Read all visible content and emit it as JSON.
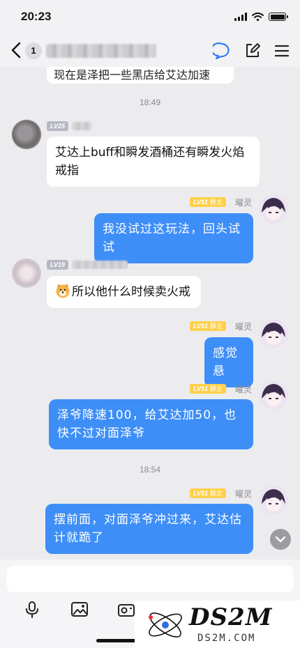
{
  "status_bar": {
    "time": "20:23"
  },
  "header": {
    "unread_count": "1",
    "icons": [
      "back-chevron-icon",
      "chat-bubble-icon",
      "edit-icon",
      "menu-icon"
    ]
  },
  "chat": {
    "top_clipped_text": "现在是泽把一些黑店给艾达加速",
    "time_1": "18:49",
    "time_2": "18:54",
    "messages": [
      {
        "side": "in",
        "level": "LV25",
        "text": "艾达上buff和瞬发酒桶还有瞬发火焰戒指"
      },
      {
        "side": "out",
        "level": "LV51",
        "tag": "群主",
        "nickname": "曜灵",
        "text": "我没试过这玩法，回头试试"
      },
      {
        "side": "in",
        "level": "LV19",
        "emoji": "doge-emoji",
        "text": "所以他什么时候卖火戒"
      },
      {
        "side": "out",
        "level": "LV51",
        "tag": "群主",
        "nickname": "曜灵",
        "text": "感觉悬"
      },
      {
        "side": "out",
        "level": "LV51",
        "tag": "群主",
        "nickname": "曜灵",
        "text": "泽爷降速100，给艾达加50，也快不过对面泽爷"
      },
      {
        "side": "out",
        "level": "LV51",
        "tag": "群主",
        "nickname": "曜灵",
        "text": "摆前面，对面泽爷冲过来，艾达估计就跪了"
      }
    ]
  },
  "input": {
    "value": "",
    "placeholder": ""
  },
  "toolbar": {
    "icons": [
      "microphone-icon",
      "image-icon",
      "camera-icon"
    ]
  },
  "watermark": {
    "main": "DS2M",
    "sub": "DS2M.COM"
  },
  "colors": {
    "outgoing_bubble": "#3e8ef7",
    "accent": "#3e8ef7",
    "level_gold": "#ffd04b",
    "level_gray": "#b6b8c4"
  }
}
